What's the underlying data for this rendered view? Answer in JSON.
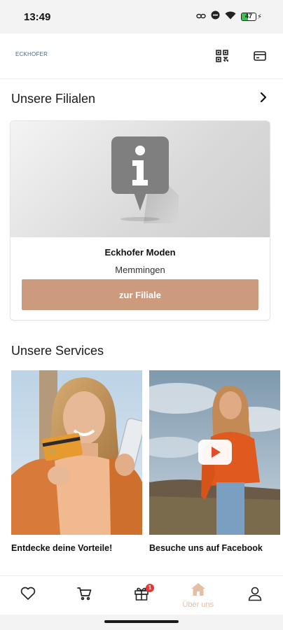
{
  "status_bar": {
    "time": "13:49",
    "battery_text": "47",
    "battery_level": 0.47,
    "icons": [
      "link-icon",
      "do-not-disturb-icon",
      "wifi-icon",
      "battery-icon"
    ]
  },
  "header": {
    "brand_text": "ECKHOFER",
    "actions": [
      "qr-code-icon",
      "card-icon"
    ]
  },
  "stores": {
    "title": "Unsere Filialen",
    "card": {
      "image_icon": "info-pin-icon",
      "name": "Eckhofer Moden",
      "city": "Memmingen",
      "button_label": "zur Filiale"
    }
  },
  "services": {
    "title": "Unsere Services",
    "items": [
      {
        "label": "Entdecke deine Vorteile!"
      },
      {
        "label": "Besuche uns auf Facebook",
        "overlay_icon": "play-icon"
      }
    ]
  },
  "bottom_nav": {
    "items": [
      {
        "icon": "heart-icon"
      },
      {
        "icon": "cart-icon"
      },
      {
        "icon": "gift-icon",
        "badge": "1"
      },
      {
        "icon": "home-icon",
        "label": "Über uns",
        "active": true
      },
      {
        "icon": "user-icon"
      }
    ]
  },
  "colors": {
    "accent": "#cc9a7d",
    "active_nav": "#e3bfa5",
    "badge": "#e53935"
  }
}
